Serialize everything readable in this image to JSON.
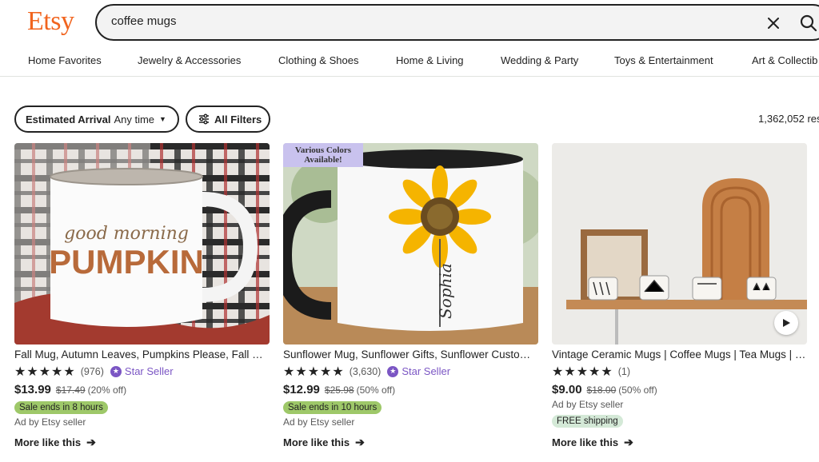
{
  "header": {
    "logo": "Etsy",
    "search_value": "coffee mugs"
  },
  "categories": [
    "Home Favorites",
    "Jewelry & Accessories",
    "Clothing & Shoes",
    "Home & Living",
    "Wedding & Party",
    "Toys & Entertainment",
    "Art & Collectib"
  ],
  "filters": {
    "arrival_label": "Estimated Arrival",
    "arrival_value": "Any time",
    "all_filters": "All Filters",
    "results": "1,362,052 res"
  },
  "listings": [
    {
      "title": "Fall Mug, Autumn Leaves, Pumpkins Please, Fall Mug Gift",
      "rating": 5,
      "review_count": "(976)",
      "star_seller": "Star Seller",
      "price": "$13.99",
      "original_price": "$17.49",
      "discount": "(20% off)",
      "badge": "Sale ends in 8 hours",
      "ad": "Ad by Etsy seller",
      "more": "More like this",
      "image_text_1": "good morning",
      "image_text_2": "PUMPKIN"
    },
    {
      "title": "Sunflower Mug, Sunflower Gifts, Sunflower Custom Name Mug",
      "rating": 5,
      "review_count": "(3,630)",
      "star_seller": "Star Seller",
      "price": "$12.99",
      "original_price": "$25.98",
      "discount": "(50% off)",
      "badge": "Sale ends in 10 hours",
      "ad": "Ad by Etsy seller",
      "more": "More like this",
      "image_tag_line1": "Various Colors",
      "image_tag_line2": "Available!",
      "image_text_1": "Sophia"
    },
    {
      "title": "Vintage Ceramic Mugs | Coffee Mugs | Tea Mugs | Handmade",
      "rating": 5,
      "review_count": "(1)",
      "price": "$9.00",
      "original_price": "$18.00",
      "discount": "(50% off)",
      "ad": "Ad by Etsy seller",
      "badge": "FREE shipping",
      "more": "More like this"
    }
  ],
  "colors": {
    "brand": "#f1641e",
    "star_seller": "#7b56c4",
    "sale_badge": "#9ec869",
    "shipping_badge": "#d4e9d7"
  }
}
